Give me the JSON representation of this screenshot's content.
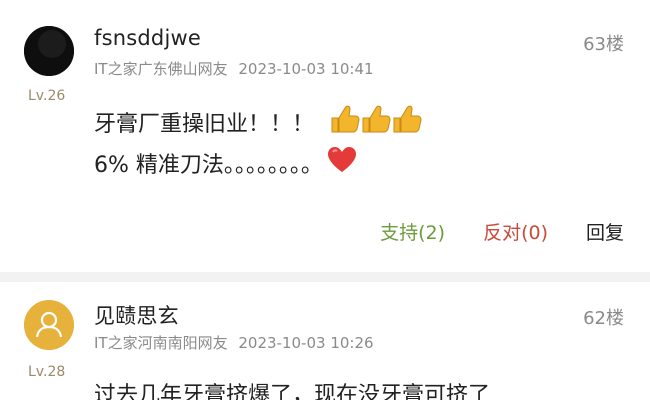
{
  "comments": [
    {
      "username": "fsnsddjwe",
      "source": "IT之家广东佛山网友",
      "time": "2023-10-03 10:41",
      "floor": "63楼",
      "level": "Lv.26",
      "content_lines": [
        "牙膏厂重操旧业！！！",
        "6% 精准刀法。。。。。。。。"
      ],
      "emoji_line1": "thumbs-up x3",
      "emoji_line2": "red-heart",
      "support_label": "支持(2)",
      "oppose_label": "反对(0)",
      "reply_label": "回复"
    },
    {
      "username": "见赜思玄",
      "source": "IT之家河南南阳网友",
      "time": "2023-10-03 10:26",
      "floor": "62楼",
      "level": "Lv.28",
      "content_lines": [
        "过去几年牙膏挤爆了，现在没牙膏可挤了"
      ]
    }
  ],
  "colors": {
    "support": "#6b9b3a",
    "oppose": "#c84a3a",
    "muted": "#8a8a8a",
    "level": "#9a8a6a",
    "avatar_default": "#e6b23c"
  }
}
